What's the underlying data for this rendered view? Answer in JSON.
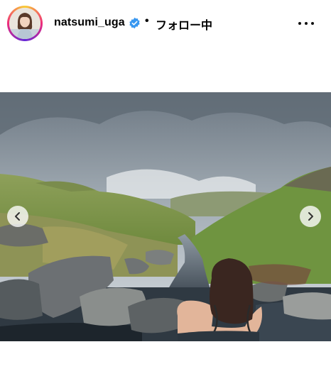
{
  "post": {
    "username": "natsumi_uga",
    "separator": "•",
    "follow_status": "フォロー中"
  },
  "icons": {
    "avatar": "profile-avatar",
    "verified": "verified-badge-icon",
    "more": "more-horizontal-icon",
    "prev": "chevron-left-icon",
    "next": "chevron-right-icon"
  },
  "colors": {
    "verified": "#3897f0",
    "text": "#000000",
    "nav_button_bg": "#ffffff"
  }
}
